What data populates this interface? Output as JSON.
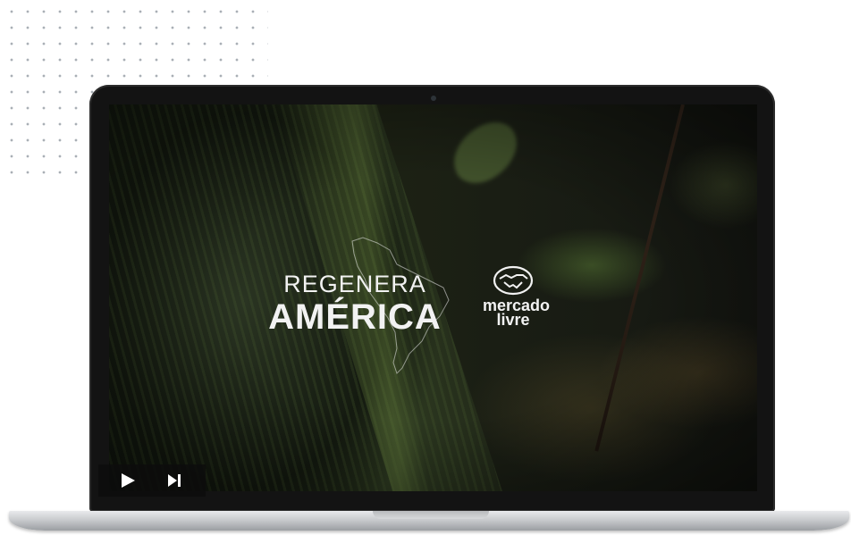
{
  "video": {
    "title_line1": "REGENERA",
    "title_line2": "AMÉRICA",
    "logo": {
      "icon": "handshake-icon",
      "line1": "mercado",
      "line2": "livre"
    }
  },
  "controls": {
    "play_icon": "play-icon",
    "next_icon": "skip-next-icon"
  },
  "colors": {
    "screen_bezel": "#131313",
    "overlay_text": "#f2f2f2",
    "controls_bg": "#0c0c0c"
  }
}
